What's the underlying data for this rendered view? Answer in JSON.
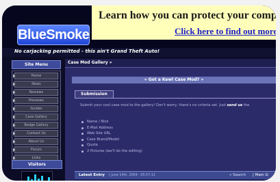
{
  "header": {
    "logo": "BlueSmoke",
    "tagline": "No carjacking permitted - this ain't Grand Theft Auto!"
  },
  "banner": {
    "title": "Learn how you can protect your compu",
    "link": "Click here to find out more."
  },
  "sidebar": {
    "title": "Site Menu",
    "items": [
      "Home",
      "News",
      "Reviews",
      "Previews",
      "Guides",
      "Case Gallery",
      "Badge Gallery",
      "Contact Us",
      "About Us",
      "Forum",
      "Links"
    ],
    "visitors_title": "Visitors",
    "visitors_bars": [
      0.4,
      0.75,
      0.55,
      0.9,
      0.6,
      0.8,
      0.45,
      0.7
    ]
  },
  "main": {
    "gallery_title": "Case Mod Gallery »",
    "kewl_title": "« Got a Kewl Case Mod? »",
    "submission_tab": "Submission",
    "submission_text": "Submit your cool case mod to the gallery! Don't worry, there's no criteria set. Just",
    "submission_emphasis": "send us",
    "submission_text_tail": "the",
    "bullets": [
      "Name / Nick",
      "E-Mail Address",
      "Web Site URL",
      "Case Brand/Model",
      "Quote",
      "2 Pictures (we'll do the editing)"
    ],
    "latest_label": "Latest Entry",
    "latest_date": "( June 14th, 2004 - 05:57:11",
    "search_link": "« Search",
    "main_link": "| Main G"
  },
  "colors": {
    "logo_blue": "#3a63ec",
    "banner_yellow": "#ffffba",
    "panel_purple": "#2c2b6a",
    "visitors_cyan": "#2ad3ff"
  }
}
